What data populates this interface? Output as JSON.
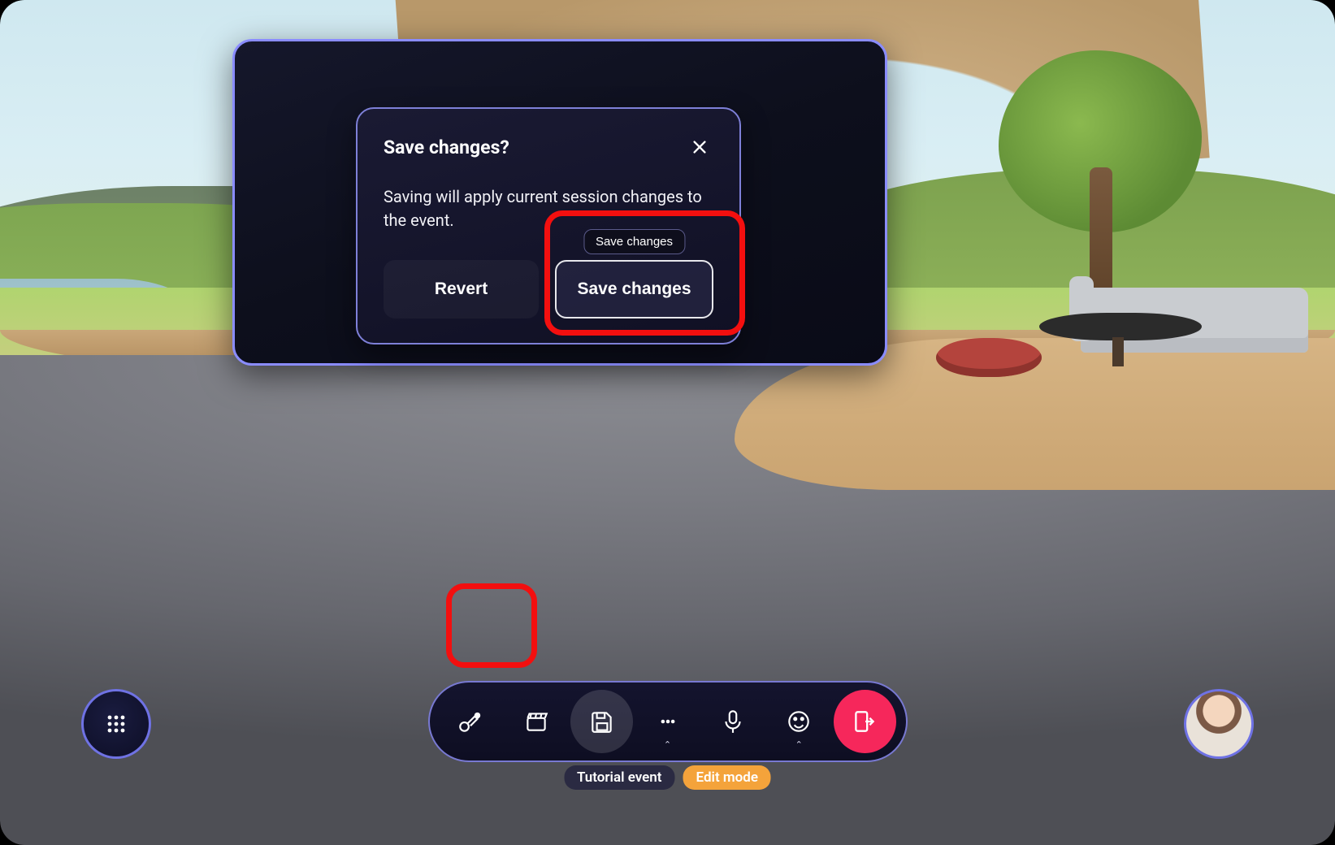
{
  "dialog": {
    "title": "Save changes?",
    "body": "Saving will apply current session changes to the event.",
    "revert_label": "Revert",
    "save_label": "Save changes",
    "tooltip": "Save changes"
  },
  "toolbar": {
    "items": {
      "customize": "customize",
      "scene": "scene",
      "save": "save",
      "more": "more",
      "mic": "microphone",
      "react": "react",
      "leave": "leave"
    }
  },
  "status": {
    "event_label": "Tutorial event",
    "mode_label": "Edit mode"
  },
  "colors": {
    "accent_border": "#8a8cff",
    "highlight": "#f30f0f",
    "leave": "#f6275b",
    "mode_badge": "#f4a33b"
  }
}
